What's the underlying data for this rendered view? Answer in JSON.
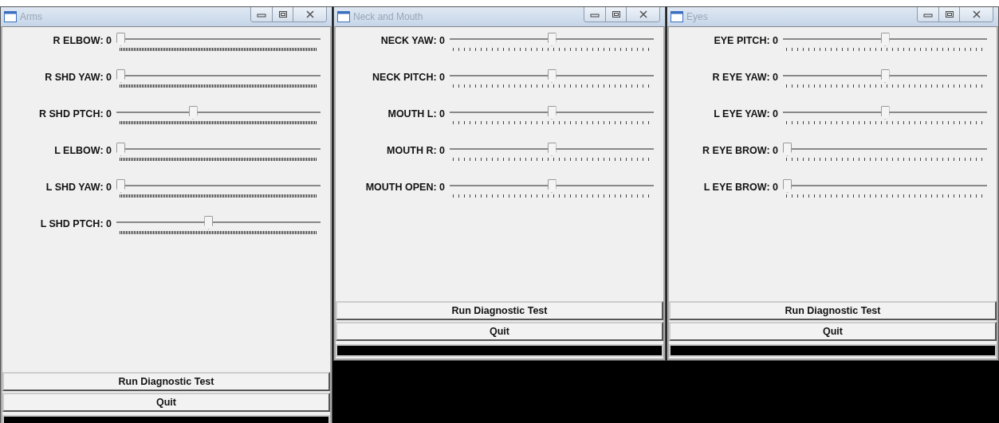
{
  "windows": [
    {
      "title": "Arms",
      "sliders": [
        {
          "label": "R ELBOW: 0",
          "level": 0
        },
        {
          "label": "R SHD YAW: 0",
          "level": 0
        },
        {
          "label": "R SHD PTCH: 0",
          "level": 0.37
        },
        {
          "label": "L ELBOW: 0",
          "level": 0
        },
        {
          "label": "L SHD YAW: 0",
          "level": 0
        },
        {
          "label": "L SHD PTCH: 0",
          "level": 0.45
        }
      ],
      "buttons": [
        "Run Diagnostic Test",
        "Quit"
      ],
      "tall": true
    },
    {
      "title": "Neck and Mouth",
      "sliders": [
        {
          "label": "NECK YAW: 0",
          "level": 0.5
        },
        {
          "label": "NECK PITCH: 0",
          "level": 0.5
        },
        {
          "label": "MOUTH L: 0",
          "level": 0.5
        },
        {
          "label": "MOUTH R: 0",
          "level": 0.5
        },
        {
          "label": "MOUTH OPEN: 0",
          "level": 0.5
        }
      ],
      "buttons": [
        "Run Diagnostic Test",
        "Quit"
      ],
      "tall": false
    },
    {
      "title": "Eyes",
      "sliders": [
        {
          "label": "EYE PITCH: 0",
          "level": 0.5
        },
        {
          "label": "R EYE YAW: 0",
          "level": 0.5
        },
        {
          "label": "L EYE YAW: 0",
          "level": 0.5
        },
        {
          "label": "R EYE BROW: 0",
          "level": 0
        },
        {
          "label": "L EYE BROW: 0",
          "level": 0
        }
      ],
      "buttons": [
        "Run Diagnostic Test",
        "Quit"
      ],
      "tall": false
    }
  ]
}
